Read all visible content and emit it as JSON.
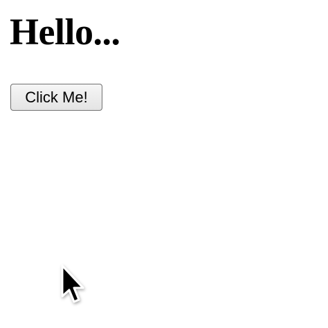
{
  "main": {
    "heading": "Hello...",
    "button_label": "Click Me!"
  },
  "cursor": {
    "icon": "arrow-pointer-icon"
  }
}
